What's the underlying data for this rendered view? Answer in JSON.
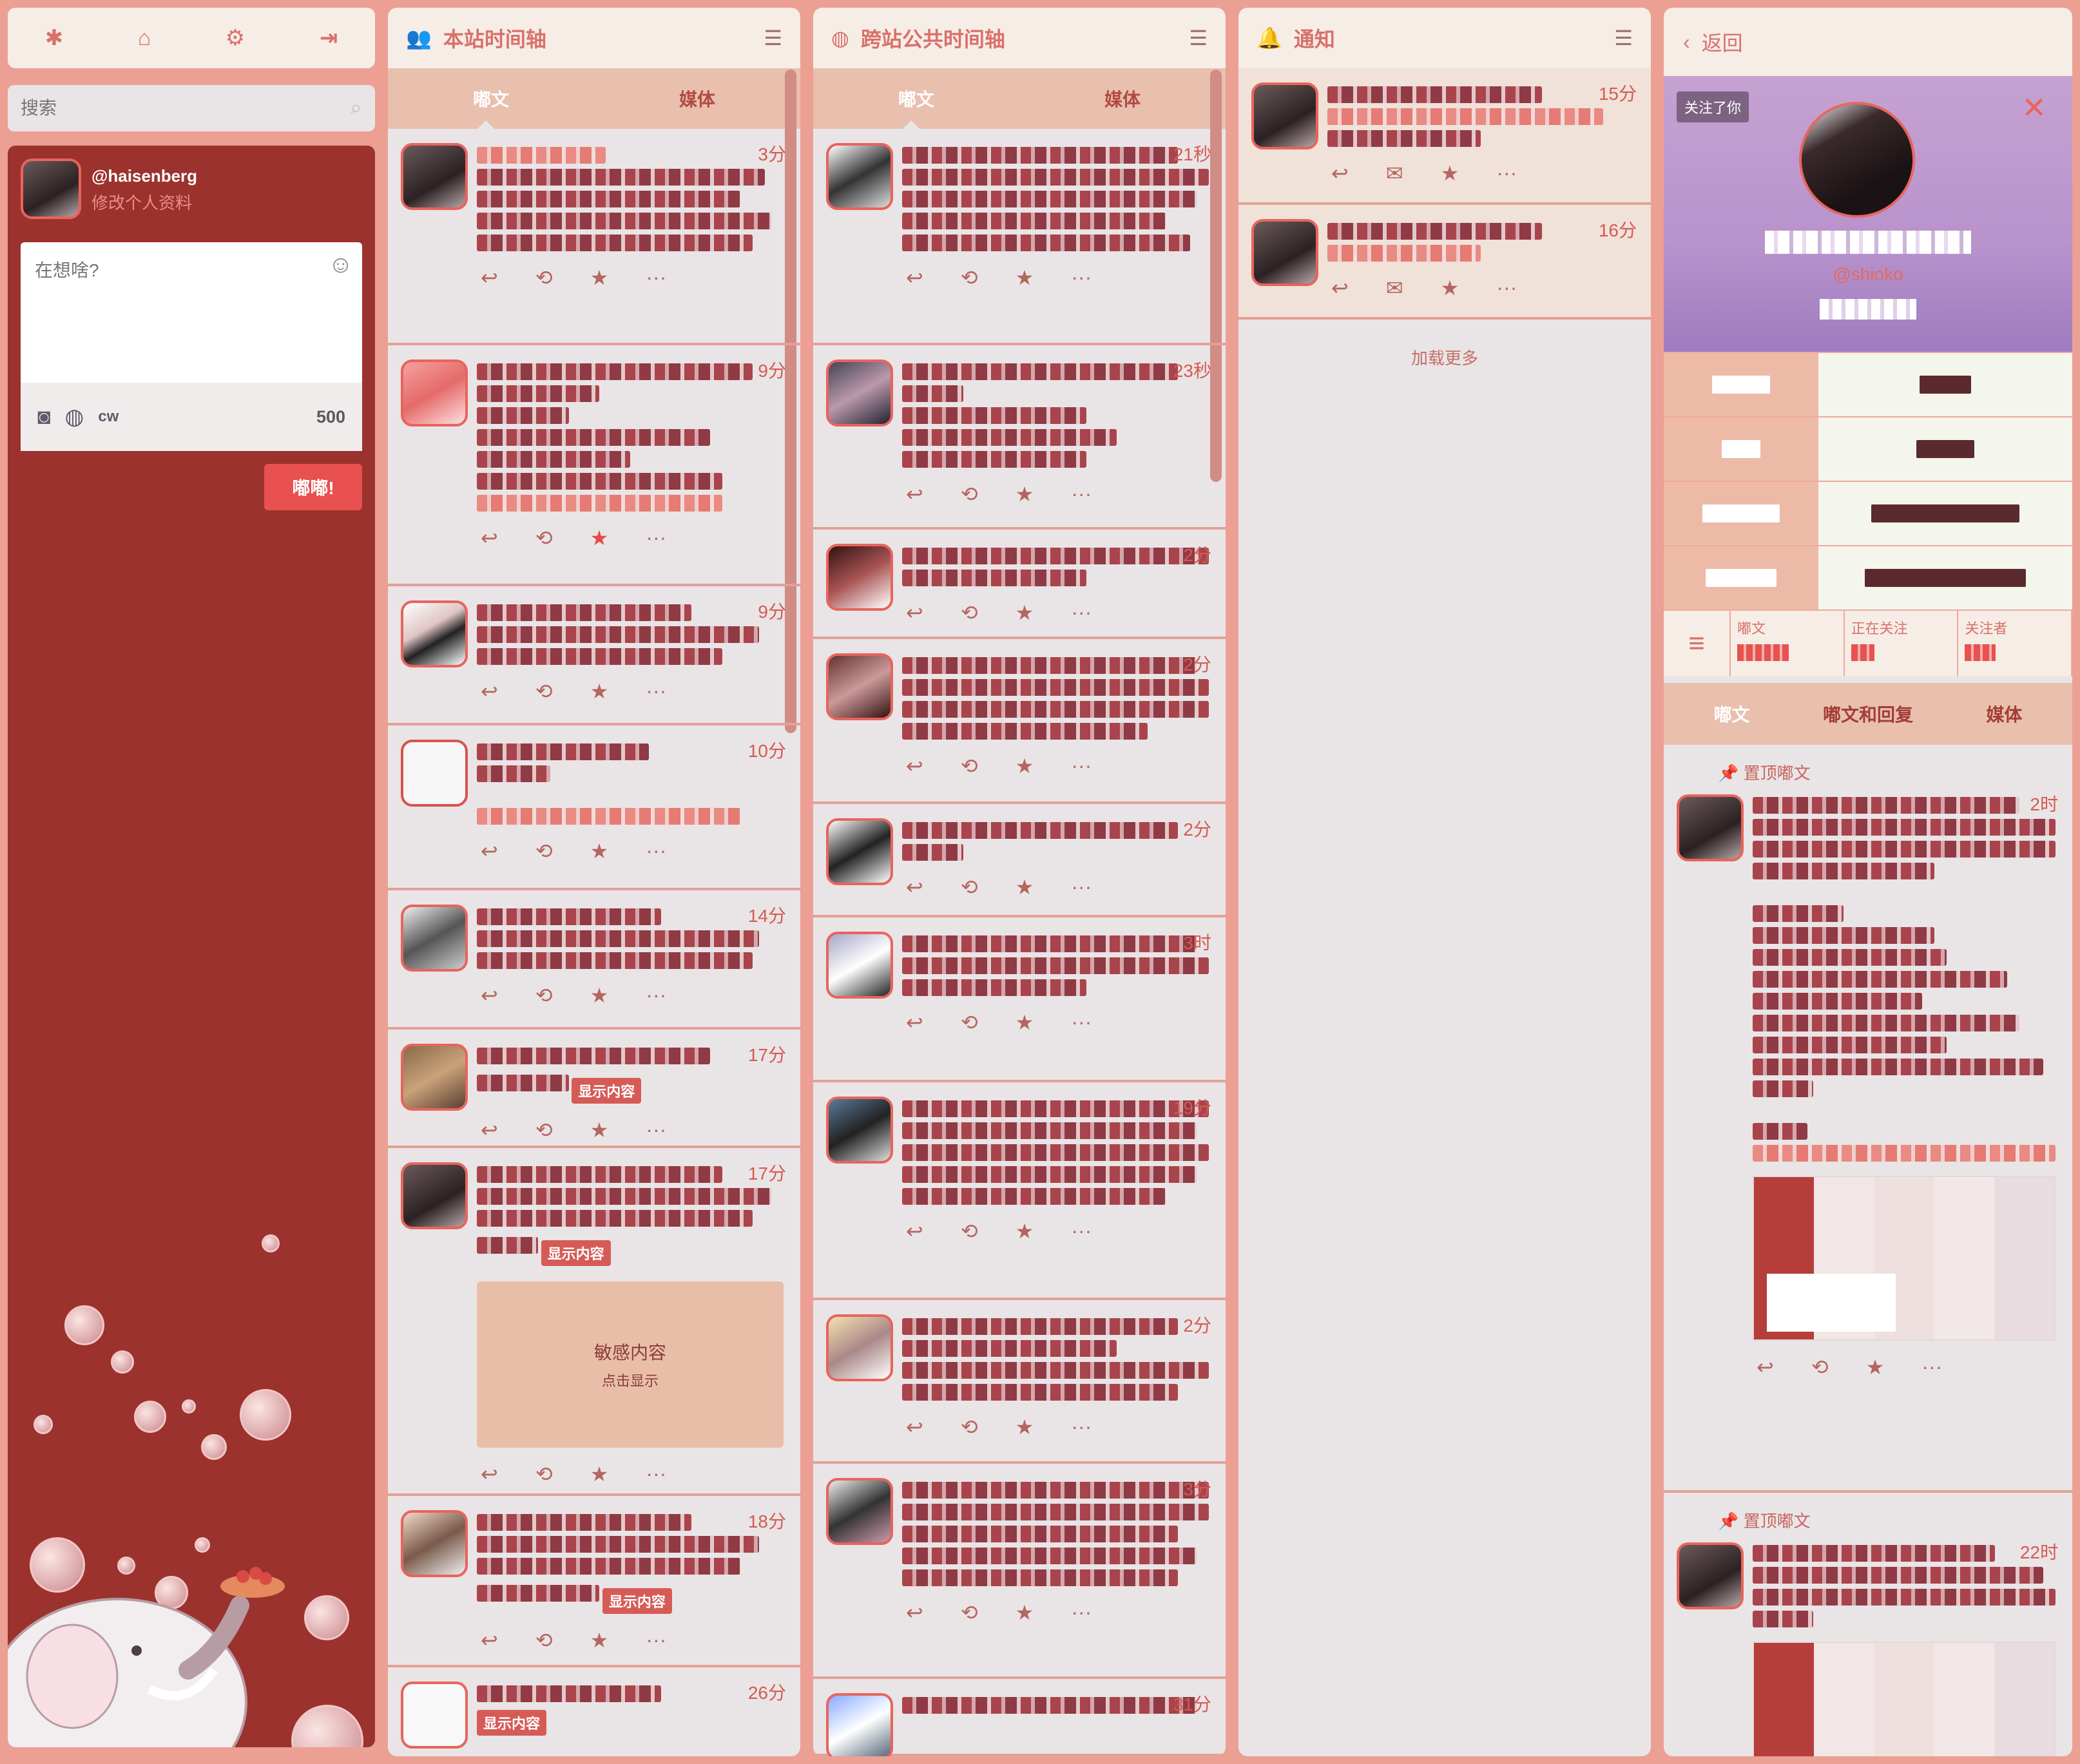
{
  "nav": {
    "icons": [
      "asterisk-icon",
      "home-icon",
      "gear-icon",
      "logout-icon"
    ]
  },
  "search": {
    "placeholder": "搜索"
  },
  "account": {
    "username": "@haisenberg",
    "edit_profile": "修改个人资料"
  },
  "compose": {
    "placeholder": "在想啥?",
    "cw_label": "cw",
    "char_count": "500",
    "submit_label": "嘟嘟!"
  },
  "home": {
    "title": "本站时间轴",
    "tabs": [
      "嘟文",
      "媒体"
    ],
    "statuses": [
      {
        "time": "3分"
      },
      {
        "time": "9分",
        "faved": true
      },
      {
        "time": "9分"
      },
      {
        "time": "10分"
      },
      {
        "time": "14分"
      },
      {
        "time": "17分",
        "badge": "显示内容"
      },
      {
        "time": "17分",
        "badge": "显示内容",
        "sensitive": "敏感内容",
        "sensitive_hint": "点击显示"
      },
      {
        "time": "18分",
        "badge": "显示内容"
      },
      {
        "time": "26分",
        "badge": "显示内容"
      }
    ]
  },
  "federated": {
    "title": "跨站公共时间轴",
    "tabs": [
      "嘟文",
      "媒体"
    ],
    "statuses": [
      {
        "time": "21秒"
      },
      {
        "time": "23秒"
      },
      {
        "time": "2分"
      },
      {
        "time": "2分"
      },
      {
        "time": "2分"
      },
      {
        "time": "3时"
      },
      {
        "time": "19分"
      },
      {
        "time": "2分"
      },
      {
        "time": "3分"
      },
      {
        "time": "31分"
      }
    ]
  },
  "notifications": {
    "title": "通知",
    "items": [
      {
        "time": "15分"
      },
      {
        "time": "16分"
      }
    ],
    "load_more": "加载更多"
  },
  "profile": {
    "back": "返回",
    "follows_you": "关注了你",
    "acct": "@shioko",
    "counts": [
      {
        "label": "嘟文"
      },
      {
        "label": "正在关注"
      },
      {
        "label": "关注者"
      }
    ],
    "tabs": [
      "嘟文",
      "嘟文和回复",
      "媒体"
    ],
    "pinned_label": "置顶嘟文",
    "statuses": [
      {
        "time": "2时"
      },
      {
        "time": "22时"
      }
    ]
  },
  "colors": {
    "accent": "#e8645d",
    "drawer": "#9b322e",
    "column_bg": "#e9e5e6",
    "header_bg": "#f6ede6",
    "tab_bg": "#e9bfae"
  }
}
